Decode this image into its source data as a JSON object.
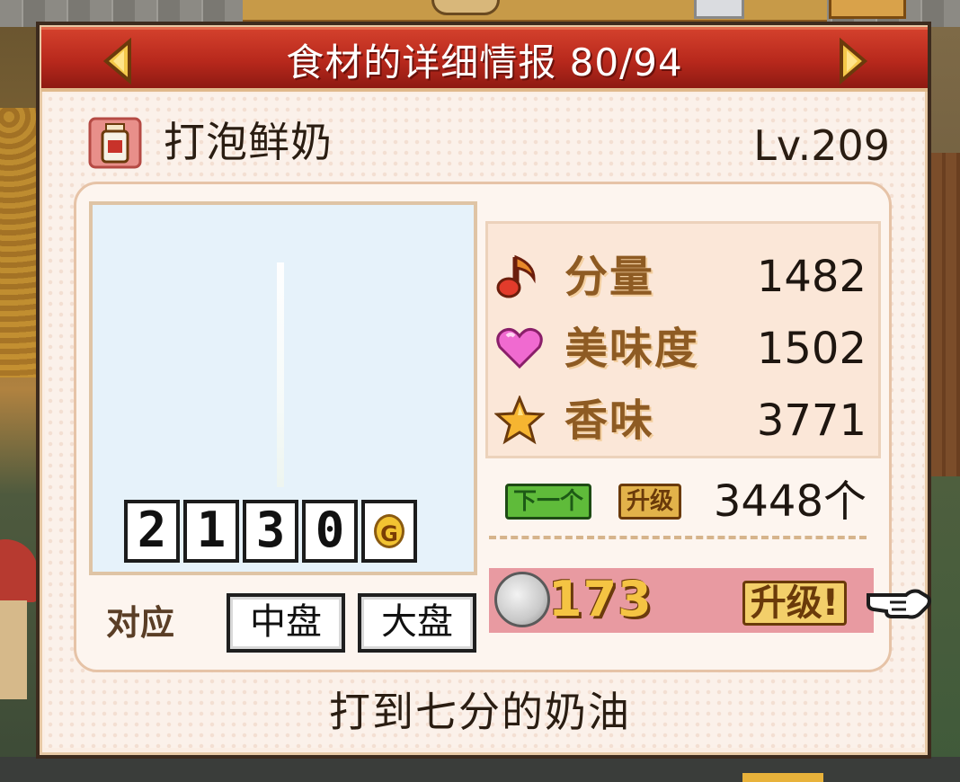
{
  "title": "食材的详细情报 80/94",
  "ingredient": {
    "name": "打泡鲜奶",
    "level": "Lv.209",
    "icon": "milk-bottle-icon",
    "description": "打到七分的奶油"
  },
  "price": {
    "digits": [
      "2",
      "1",
      "3",
      "0"
    ],
    "currency_symbol": "G"
  },
  "compat": {
    "label": "对应",
    "plates": [
      "中盘",
      "大盘"
    ]
  },
  "stats": {
    "amount": {
      "label": "分量",
      "value": "1482",
      "icon": "music-note-icon"
    },
    "taste": {
      "label": "美味度",
      "value": "1502",
      "icon": "heart-icon"
    },
    "aroma": {
      "label": "香味",
      "value": "3771",
      "icon": "star-icon"
    }
  },
  "next_level": {
    "next_label": "下一个",
    "upgrade_label": "升级",
    "count": "3448个"
  },
  "upgrade": {
    "cost": "173",
    "label": "升级!",
    "coin_icon": "silver-coin-icon"
  },
  "colors": {
    "titlebar": "#b7281c",
    "upgrade_bar": "#e89aa1",
    "stat_label": "#8e5b23"
  }
}
